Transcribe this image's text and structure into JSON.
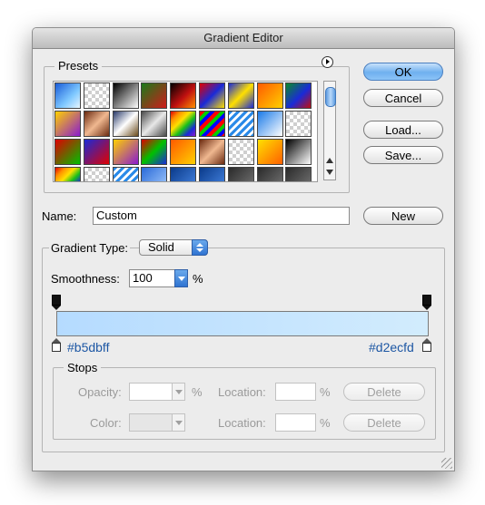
{
  "window": {
    "title": "Gradient Editor"
  },
  "presets": {
    "label": "Presets",
    "menu_icon": "circle-triangle-icon",
    "rows": [
      [
        "transparent-blue",
        "checker",
        "black-white",
        "green-red",
        "red-black",
        "red-blue-yellow",
        "blue-yellow-blue",
        "orange-yellow",
        "green-blue"
      ],
      [
        "yellow-violet",
        "copper",
        "chrome",
        "steel",
        "rainbow",
        "diagonal-rainbow",
        "blue-stripes",
        "blue-white",
        "checker"
      ],
      [
        "red-green",
        "blue-red",
        "yellow-violet",
        "red-green-blue",
        "orange-yellow",
        "copper",
        "checker",
        "yellow-orange",
        "black-white"
      ],
      [
        "rainbow",
        "checker",
        "blue-stripes",
        "blue-fade",
        "blue-dark",
        "blue-dark",
        "dark-fade",
        "dark-fade",
        "dark-fade"
      ]
    ]
  },
  "buttons": {
    "ok": "OK",
    "cancel": "Cancel",
    "load": "Load...",
    "save": "Save...",
    "new": "New"
  },
  "name": {
    "label": "Name:",
    "value": "Custom"
  },
  "gradient_type": {
    "label": "Gradient Type:",
    "value": "Solid"
  },
  "smoothness": {
    "label": "Smoothness:",
    "value": "100",
    "unit": "%"
  },
  "gradient": {
    "start_color": "#b5dbff",
    "end_color": "#d2ecfd",
    "start_label": "#b5dbff",
    "end_label": "#d2ecfd"
  },
  "stops": {
    "label": "Stops",
    "opacity_label": "Opacity:",
    "opacity_unit": "%",
    "color_label": "Color:",
    "location_label": "Location:",
    "location_unit": "%",
    "delete_label": "Delete"
  }
}
